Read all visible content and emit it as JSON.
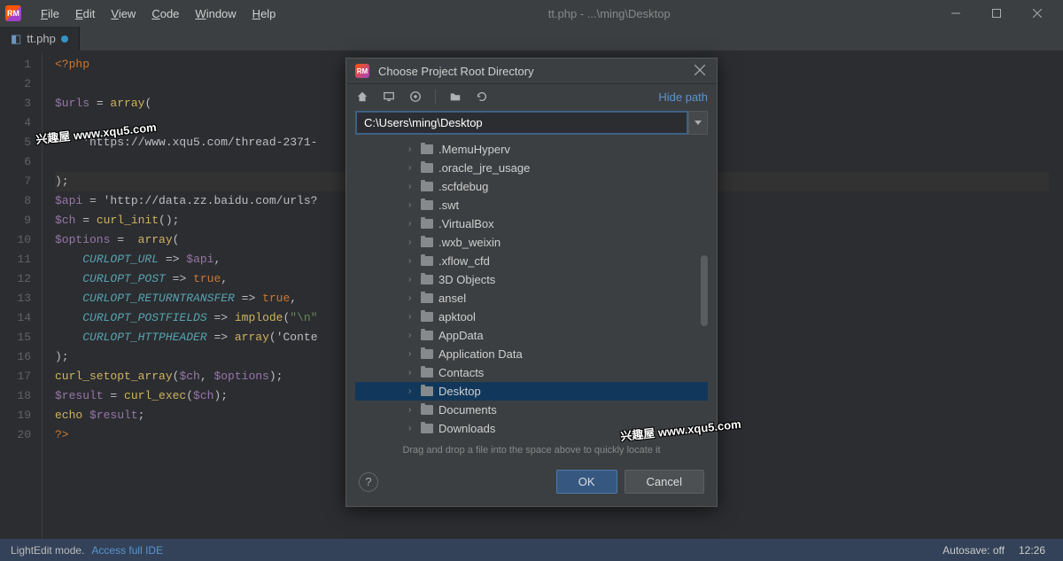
{
  "titlebar": {
    "menus": [
      "File",
      "Edit",
      "View",
      "Code",
      "Window",
      "Help"
    ],
    "title": "tt.php - ...\\ming\\Desktop"
  },
  "tab": {
    "name": "tt.php"
  },
  "gutter_lines": [
    "1",
    "2",
    "3",
    "4",
    "5",
    "6",
    "7",
    "8",
    "9",
    "10",
    "11",
    "12",
    "13",
    "14",
    "15",
    "16",
    "17",
    "18",
    "19",
    "20"
  ],
  "code_lines": [
    {
      "t": "<?php",
      "c": "c-orange"
    },
    {
      "t": ""
    },
    {
      "t": "$urls = array("
    },
    {
      "t": ""
    },
    {
      "t": "    'https://www.xqu5.com/thread-2371-"
    },
    {
      "t": ""
    },
    {
      "t": ");",
      "hl": true
    },
    {
      "t": "$api = 'http://data.zz.baidu.com/urls?"
    },
    {
      "t": "$ch = curl_init();"
    },
    {
      "t": "$options =  array("
    },
    {
      "t": "    CURLOPT_URL => $api,"
    },
    {
      "t": "    CURLOPT_POST => true,"
    },
    {
      "t": "    CURLOPT_RETURNTRANSFER => true,"
    },
    {
      "t": "    CURLOPT_POSTFIELDS => implode(\"\\n\""
    },
    {
      "t": "    CURLOPT_HTTPHEADER => array('Conte"
    },
    {
      "t": ");"
    },
    {
      "t": "curl_setopt_array($ch, $options);"
    },
    {
      "t": "$result = curl_exec($ch);"
    },
    {
      "t": "echo $result;"
    },
    {
      "t": "?>"
    }
  ],
  "dialog": {
    "title": "Choose Project Root Directory",
    "hide_path": "Hide path",
    "path": "C:\\Users\\ming\\Desktop",
    "hint": "Drag and drop a file into the space above to quickly locate it",
    "ok": "OK",
    "cancel": "Cancel",
    "folders": [
      ".MemuHyperv",
      ".oracle_jre_usage",
      ".scfdebug",
      ".swt",
      ".VirtualBox",
      ".wxb_weixin",
      ".xflow_cfd",
      "3D Objects",
      "ansel",
      "apktool",
      "AppData",
      "Application Data",
      "Contacts",
      "Desktop",
      "Documents",
      "Downloads"
    ],
    "selected_index": 13
  },
  "statusbar": {
    "mode": "LightEdit mode.",
    "link": "Access full IDE",
    "autosave": "Autosave: off",
    "time": "12:26"
  },
  "watermark": "兴趣屋 www.xqu5.com"
}
